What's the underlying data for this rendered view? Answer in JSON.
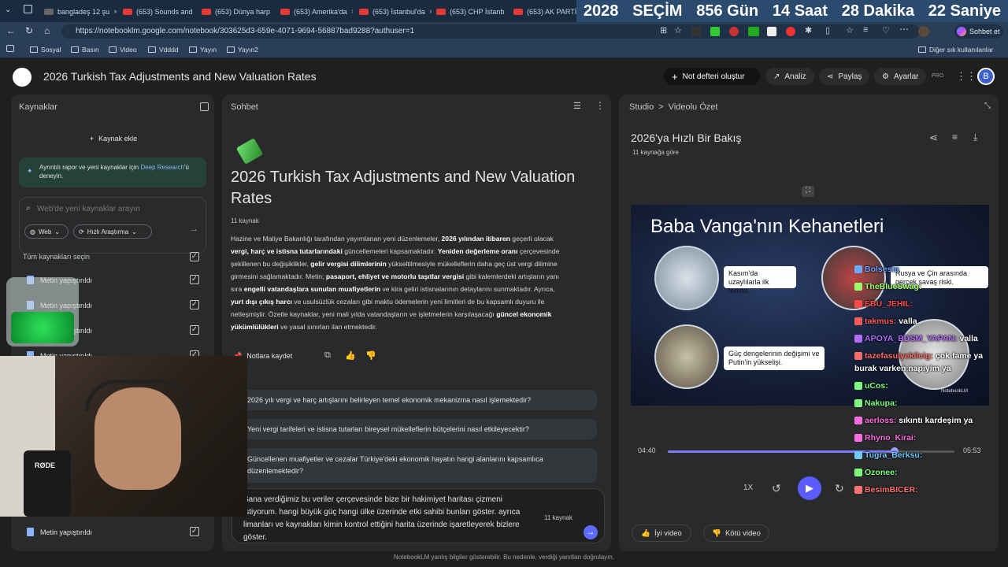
{
  "browser": {
    "tabs": [
      {
        "title": "bangladeş 12 şu"
      },
      {
        "title": "(653) Sounds and"
      },
      {
        "title": "(653) Dünya harp"
      },
      {
        "title": "(653) Amerika'da"
      },
      {
        "title": "(653) İstanbul'da"
      },
      {
        "title": "(653) CHP İstanb"
      },
      {
        "title": "(653) AK PARTİ'D"
      }
    ],
    "countdown": [
      "2028",
      "SEÇİM",
      "856 Gün",
      "14 Saat",
      "28 Dakika",
      "22 Saniye"
    ],
    "url": "https://notebooklm.google.com/notebook/303625d3-659e-4071-9694-56887bad9288?authuser=1",
    "profile_label": "Sohbet et",
    "bookmarks": [
      "Sosyal",
      "Basın",
      "Video",
      "Vdddd",
      "Yayın",
      "Yayın2"
    ],
    "other_bookmarks": "Diğer sık kullanılanlar"
  },
  "header": {
    "title": "2026 Turkish Tax Adjustments and New Valuation Rates",
    "create_notebook": "Not defteri oluştur",
    "analytics": "Analiz",
    "share": "Paylaş",
    "settings": "Ayarlar",
    "pro": "PRO",
    "avatar": "B"
  },
  "sources": {
    "title": "Kaynaklar",
    "add": "Kaynak ekle",
    "deep_research_prefix": "Ayrıntılı rapor ve yeni kaynaklar için ",
    "deep_research_link": "Deep Research",
    "deep_research_suffix": "'ü deneyin.",
    "search_placeholder": "Web'de yeni kaynaklar arayın",
    "web_chip": "Web",
    "fast_chip": "Hızlı Araştırma",
    "select_all": "Tüm kaynakları seçin",
    "items": [
      "Metin yapıştırıldı",
      "Metin yapıştırıldı",
      "Metin yapıştırıldı",
      "Metin yapıştırıldı",
      "Metin yapıştırıldı"
    ]
  },
  "chat": {
    "title": "Sohbet",
    "heading": "2026 Turkish Tax Adjustments and New Valuation Rates",
    "source_count": "11 kaynak",
    "summary_lines": [
      [
        "Hazine ve Maliye Bakanlığı tarafından yayımlanan yeni düzenlemeler, ",
        "2026 yılından itibaren",
        " geçerli olacak"
      ],
      [
        "",
        "vergi, harç ve istisna tutarlarındaki",
        " güncellemeleri kapsamaktadır. ",
        "Yeniden değerleme oranı",
        " çerçevesinde"
      ],
      [
        "şekillenen bu değişiklikler, ",
        "gelir vergisi dilimlerinin",
        " yükseltilmesiyle mükelleflerin daha geç üst vergi dilimine"
      ],
      [
        "girmesini sağlamaktadır. Metin; ",
        "pasaport, ehliyet ve motorlu taşıtlar vergisi",
        " gibi kalemlerdeki artışların yanı"
      ],
      [
        "sıra ",
        "engelli vatandaşlara sunulan muafiyetlerin",
        " ve kira geliri istisnalarının detaylarını sunmaktadır. Ayrıca,"
      ],
      [
        "",
        "yurt dışı çıkış harcı",
        " ve usulsüzlük cezaları gibi maktu ödemelerin yeni limitleri de bu kapsamlı duyuru ile"
      ],
      [
        "netleşmiştir. Özetle kaynaklar, yeni mali yılda vatandaşların ve işletmelerin karşılaşacağı ",
        "güncel ekonomik"
      ],
      [
        "",
        "yükümlülükleri",
        " ve yasal sınırları ilan etmektedir."
      ]
    ],
    "save_note": "Notlara kaydet",
    "suggestions": [
      "2026 yılı vergi ve harç artışlarını belirleyen temel ekonomik mekanizma nasıl işlemektedir?",
      "Yeni vergi tarifeleri ve istisna tutarları bireysel mükelleflerin bütçelerini nasıl etkileyecektir?",
      "Güncellenen muafiyetler ve cezalar Türkiye'deki ekonomik hayatın hangi alanlarını kapsamlıca düzenlemektedir?"
    ],
    "input_text": "Sana verdiğimiz bu veriler çerçevesinde bize bir hakimiyet haritası çizmeni istiyorum. hangi büyük güç hangi ülke üzerinde etki sahibi bunları göster. ayrıca limanları ve kaynakları kimin kontrol ettiğini harita üzerinde işaretleyerek bizlere göster.",
    "input_count": "11 kaynak"
  },
  "studio": {
    "breadcrumb_root": "Studio",
    "breadcrumb_page": "Videolu Özet",
    "video_title": "2026'ya Hızlı Bir Bakış",
    "based_on": "11 kaynağa göre",
    "slide_title": "Baba Vanga'nın Kehanetleri",
    "cap1": "Kasım'da uzaylılarla ilk temas.",
    "cap2": "Rusya ve Çin arasında gerçek savaş riski.",
    "cap3": "Güç dengelerinin değişimi ve Putin'in yükselişi.",
    "watermark": "NotebookLM",
    "time_current": "04:40",
    "time_total": "05:53",
    "progress": 0.79,
    "speed": "1X",
    "good": "İyi video",
    "bad": "Kötü video"
  },
  "stream_chat": [
    {
      "user": "Bolsesta",
      "msg": "",
      "color": "#6fa8ff"
    },
    {
      "user": "TheBlueSwag:",
      "msg": "",
      "color": "#9cff6a"
    },
    {
      "user": "EBU_JEHIL:",
      "msg": "",
      "color": "#ff4a4a"
    },
    {
      "user": "takmus:",
      "msg": "valla",
      "color": "#ff5a5a"
    },
    {
      "user": "APOYA_BDSM_YAPAN:",
      "msg": "valla",
      "color": "#b66bff"
    },
    {
      "user": "tazefasulyekilcig:",
      "msg": "çok fame ya",
      "color": "#ff6b6b"
    },
    {
      "user": "",
      "msg": "burak varken napiyim ya",
      "color": "#ffffff"
    },
    {
      "user": "uCos:",
      "msg": "",
      "color": "#7dff7d"
    },
    {
      "user": "Nakupa:",
      "msg": "",
      "color": "#7dff7d"
    },
    {
      "user": "aerloss:",
      "msg": "sıkıntı kardeşim ya",
      "color": "#ff6be0"
    },
    {
      "user": "Rhyno_Kirai:",
      "msg": "",
      "color": "#ff6be0"
    },
    {
      "user": "Tugra_Berksu:",
      "msg": "",
      "color": "#6fc8ff"
    },
    {
      "user": "Ozonee:",
      "msg": "",
      "color": "#7dff7d"
    },
    {
      "user": "BesimBICER:",
      "msg": "",
      "color": "#ff7070"
    }
  ],
  "webcam_label": "RØDE",
  "footer": "NotebookLM yanlış bilgiler gösterebilir. Bu nedenle, verdiği yanıtları doğrulayın."
}
